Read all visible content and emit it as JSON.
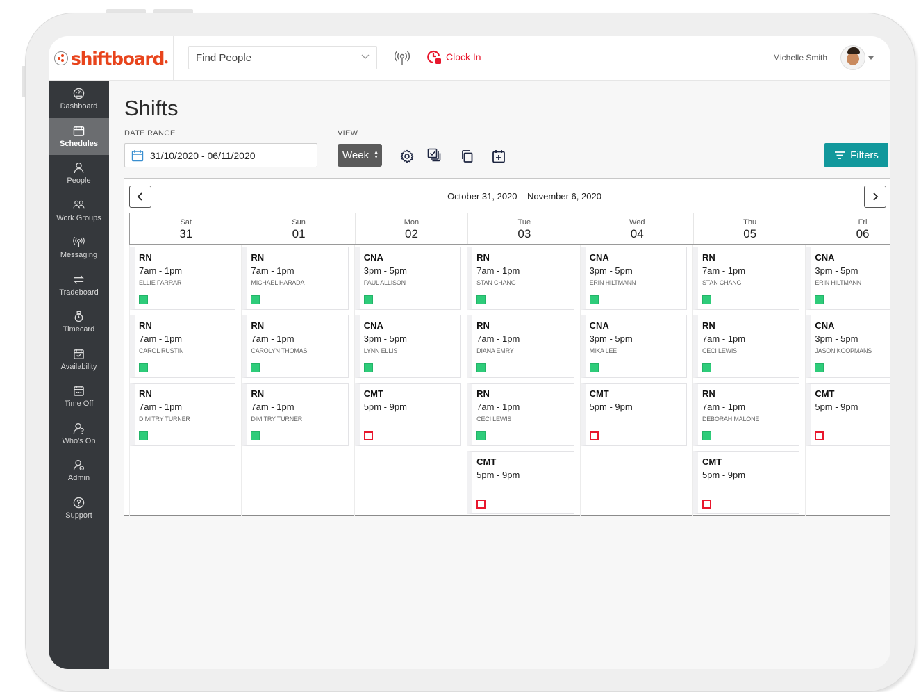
{
  "app": {
    "brand": "shiftboard",
    "brand_color": "#e8441c",
    "accent_color": "#12989c",
    "alert_color": "#e8172d"
  },
  "header": {
    "search_placeholder": "Find People",
    "broadcast_icon": "radio-broadcast-icon",
    "clock_in_label": "Clock In",
    "user_name": "Michelle Smith"
  },
  "sidebar": {
    "items": [
      {
        "label": "Dashboard",
        "icon": "dashboard-gauge-icon"
      },
      {
        "label": "Schedules",
        "icon": "calendar-icon",
        "active": true
      },
      {
        "label": "People",
        "icon": "person-icon"
      },
      {
        "label": "Work Groups",
        "icon": "group-icon"
      },
      {
        "label": "Messaging",
        "icon": "broadcast-icon"
      },
      {
        "label": "Tradeboard",
        "icon": "swap-arrows-icon"
      },
      {
        "label": "Timecard",
        "icon": "stopwatch-icon"
      },
      {
        "label": "Availability",
        "icon": "calendar-check-icon"
      },
      {
        "label": "Time Off",
        "icon": "calendar-dots-icon"
      },
      {
        "label": "Who's On",
        "icon": "person-question-icon"
      },
      {
        "label": "Admin",
        "icon": "person-gear-icon"
      },
      {
        "label": "Support",
        "icon": "question-circle-icon"
      }
    ]
  },
  "page": {
    "title": "Shifts",
    "date_range_label": "DATE RANGE",
    "date_range_value": "31/10/2020 - 06/11/2020",
    "view_label": "VIEW",
    "view_value": "Week",
    "filters_label": "Filters",
    "range_title": "October 31, 2020 – November 6, 2020"
  },
  "calendar": {
    "days": [
      {
        "name": "Sat",
        "date": "31",
        "shifts": [
          {
            "role": "RN",
            "time": "7am - 1pm",
            "person": "ELLIE FARRAR",
            "status": "filled"
          },
          {
            "role": "RN",
            "time": "7am - 1pm",
            "person": "CAROL RUSTIN",
            "status": "filled"
          },
          {
            "role": "RN",
            "time": "7am - 1pm",
            "person": "DIMITRY TURNER",
            "status": "filled"
          }
        ]
      },
      {
        "name": "Sun",
        "date": "01",
        "shifts": [
          {
            "role": "RN",
            "time": "7am - 1pm",
            "person": "MICHAEL HARADA",
            "status": "filled"
          },
          {
            "role": "RN",
            "time": "7am - 1pm",
            "person": "CAROLYN THOMAS",
            "status": "filled"
          },
          {
            "role": "RN",
            "time": "7am - 1pm",
            "person": "DIMITRY TURNER",
            "status": "filled"
          }
        ]
      },
      {
        "name": "Mon",
        "date": "02",
        "shifts": [
          {
            "role": "CNA",
            "time": "3pm - 5pm",
            "person": "PAUL ALLISON",
            "status": "filled"
          },
          {
            "role": "CNA",
            "time": "3pm - 5pm",
            "person": "LYNN ELLIS",
            "status": "filled"
          },
          {
            "role": "CMT",
            "time": "5pm - 9pm",
            "person": "",
            "status": "open"
          }
        ]
      },
      {
        "name": "Tue",
        "date": "03",
        "shifts": [
          {
            "role": "RN",
            "time": "7am - 1pm",
            "person": "STAN CHANG",
            "status": "filled"
          },
          {
            "role": "RN",
            "time": "7am - 1pm",
            "person": "DIANA EMRY",
            "status": "filled"
          },
          {
            "role": "RN",
            "time": "7am - 1pm",
            "person": "CECI LEWIS",
            "status": "filled"
          },
          {
            "role": "CMT",
            "time": "5pm - 9pm",
            "person": "",
            "status": "open"
          }
        ]
      },
      {
        "name": "Wed",
        "date": "04",
        "shifts": [
          {
            "role": "CNA",
            "time": "3pm - 5pm",
            "person": "ERIN HILTMANN",
            "status": "filled"
          },
          {
            "role": "CNA",
            "time": "3pm - 5pm",
            "person": "MIKA LEE",
            "status": "filled"
          },
          {
            "role": "CMT",
            "time": "5pm - 9pm",
            "person": "",
            "status": "open"
          }
        ]
      },
      {
        "name": "Thu",
        "date": "05",
        "shifts": [
          {
            "role": "RN",
            "time": "7am - 1pm",
            "person": "STAN CHANG",
            "status": "filled"
          },
          {
            "role": "RN",
            "time": "7am - 1pm",
            "person": "CECI LEWIS",
            "status": "filled"
          },
          {
            "role": "RN",
            "time": "7am - 1pm",
            "person": "DEBORAH MALONE",
            "status": "filled"
          },
          {
            "role": "CMT",
            "time": "5pm - 9pm",
            "person": "",
            "status": "open"
          }
        ]
      },
      {
        "name": "Fri",
        "date": "06",
        "shifts": [
          {
            "role": "CNA",
            "time": "3pm - 5pm",
            "person": "ERIN HILTMANN",
            "status": "filled"
          },
          {
            "role": "CNA",
            "time": "3pm - 5pm",
            "person": "JASON KOOPMANS",
            "status": "filled"
          },
          {
            "role": "CMT",
            "time": "5pm - 9pm",
            "person": "",
            "status": "open"
          }
        ]
      }
    ]
  }
}
